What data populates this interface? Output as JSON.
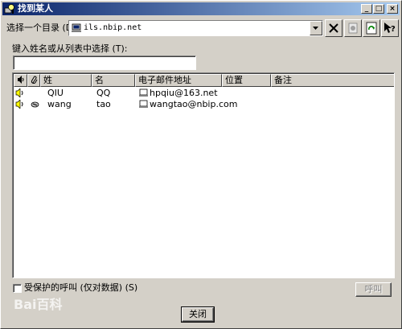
{
  "window": {
    "title": "找到某人"
  },
  "directory": {
    "label": "选择一个目录 (D):",
    "selected": "ils.nbip.net"
  },
  "search": {
    "label": "键入姓名或从列表中选择 (T):",
    "value": ""
  },
  "list": {
    "columns": [
      "",
      "",
      "姓",
      "名",
      "电子邮件地址",
      "位置",
      "备注"
    ],
    "rows": [
      {
        "speaker": "speaker-icon",
        "secure": "",
        "last": "QIU",
        "first": "QQ",
        "email": "hpqiu@163.net",
        "location": "",
        "notes": ""
      },
      {
        "speaker": "speaker-icon",
        "secure": "lock-icon",
        "last": "wang",
        "first": "tao",
        "email": "wangtao@nbip.com",
        "location": "",
        "notes": ""
      }
    ]
  },
  "options": {
    "secure_call_label": "受保护的呼叫 (仅对数据) (S)",
    "call_button": "呼叫",
    "close_button": "关闭"
  },
  "watermark": {
    "text": "Bai百科"
  },
  "colors": {
    "face": "#d4d0c8",
    "title_start": "#0a246a",
    "title_end": "#a6caf0"
  }
}
